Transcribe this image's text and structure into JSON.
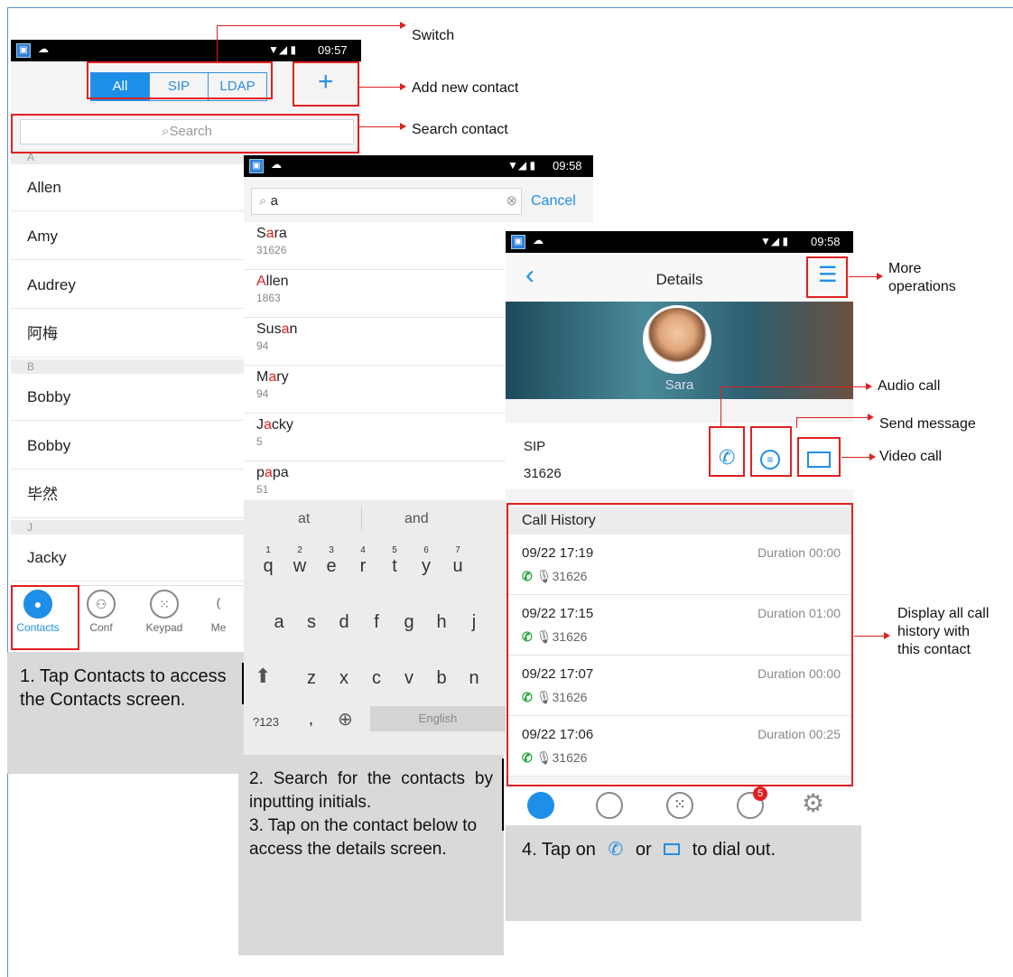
{
  "screen1": {
    "status_time": "09:57",
    "segments": [
      "All",
      "SIP",
      "LDAP"
    ],
    "add_symbol": "+",
    "search_placeholder": "Search",
    "sections": [
      "A",
      "B",
      "J"
    ],
    "contacts_a": [
      "Allen",
      "Amy",
      "Audrey",
      "阿梅"
    ],
    "contacts_b": [
      "Bobby",
      "Bobby",
      "毕然"
    ],
    "contacts_j": [
      "Jacky"
    ],
    "tabs": [
      "Contacts",
      "Conf",
      "Keypad",
      "Me"
    ]
  },
  "screen2": {
    "status_time": "09:58",
    "search_value": "a",
    "cancel_label": "Cancel",
    "results": [
      {
        "pre": "S",
        "hl": "a",
        "post": "ra",
        "num": "31626"
      },
      {
        "pre": "",
        "hl": "A",
        "post": "llen",
        "num": "1863"
      },
      {
        "pre": "Sus",
        "hl": "a",
        "post": "n",
        "num": "94"
      },
      {
        "pre": "M",
        "hl": "a",
        "post": "ry",
        "num": "94"
      },
      {
        "pre": "J",
        "hl": "a",
        "post": "cky",
        "num": "5"
      },
      {
        "pre": "p",
        "hl": "a",
        "post": "pa",
        "num": "51"
      }
    ],
    "suggestions": [
      "at",
      "and"
    ],
    "kb_row1": [
      "q",
      "w",
      "e",
      "r",
      "t",
      "y",
      "u"
    ],
    "kb_row1_nums": [
      "1",
      "2",
      "3",
      "4",
      "5",
      "6",
      "7"
    ],
    "kb_row2": [
      "a",
      "s",
      "d",
      "f",
      "g",
      "h",
      "j"
    ],
    "kb_row3": [
      "z",
      "x",
      "c",
      "v",
      "b",
      "n"
    ],
    "kb_sym": "?123",
    "kb_comma": ",",
    "kb_space": "English"
  },
  "screen3": {
    "status_time": "09:58",
    "title": "Details",
    "contact_name": "Sara",
    "account_type": "SIP",
    "account_number": "31626",
    "history_title": "Call History",
    "history": [
      {
        "time": "09/22 17:19",
        "duration": "Duration 00:00",
        "num": "31626"
      },
      {
        "time": "09/22 17:15",
        "duration": "Duration 01:00",
        "num": "31626"
      },
      {
        "time": "09/22 17:07",
        "duration": "Duration 00:00",
        "num": "31626"
      },
      {
        "time": "09/22 17:06",
        "duration": "Duration 00:25",
        "num": "31626"
      }
    ],
    "badge": "5"
  },
  "annotations": {
    "switch": "Switch",
    "add_new": "Add new contact",
    "search_contact": "Search contact",
    "more_ops_1": "More",
    "more_ops_2": "operations",
    "audio_call": "Audio call",
    "send_message": "Send message",
    "video_call": "Video call",
    "display_1": "Display all call",
    "display_2": "history with",
    "display_3": "this contact"
  },
  "steps": {
    "step1": "1. Tap Contacts to access the Contacts screen.",
    "step2": "2. Search for the contacts by inputting initials.",
    "step3": "3. Tap on the contact below to access the details screen.",
    "step4_a": "4. Tap on",
    "step4_b": "or",
    "step4_c": "to dial out."
  },
  "colors": {
    "accent": "#1e8fe8",
    "highlight": "#e02020",
    "call_green": "#22a33a"
  }
}
